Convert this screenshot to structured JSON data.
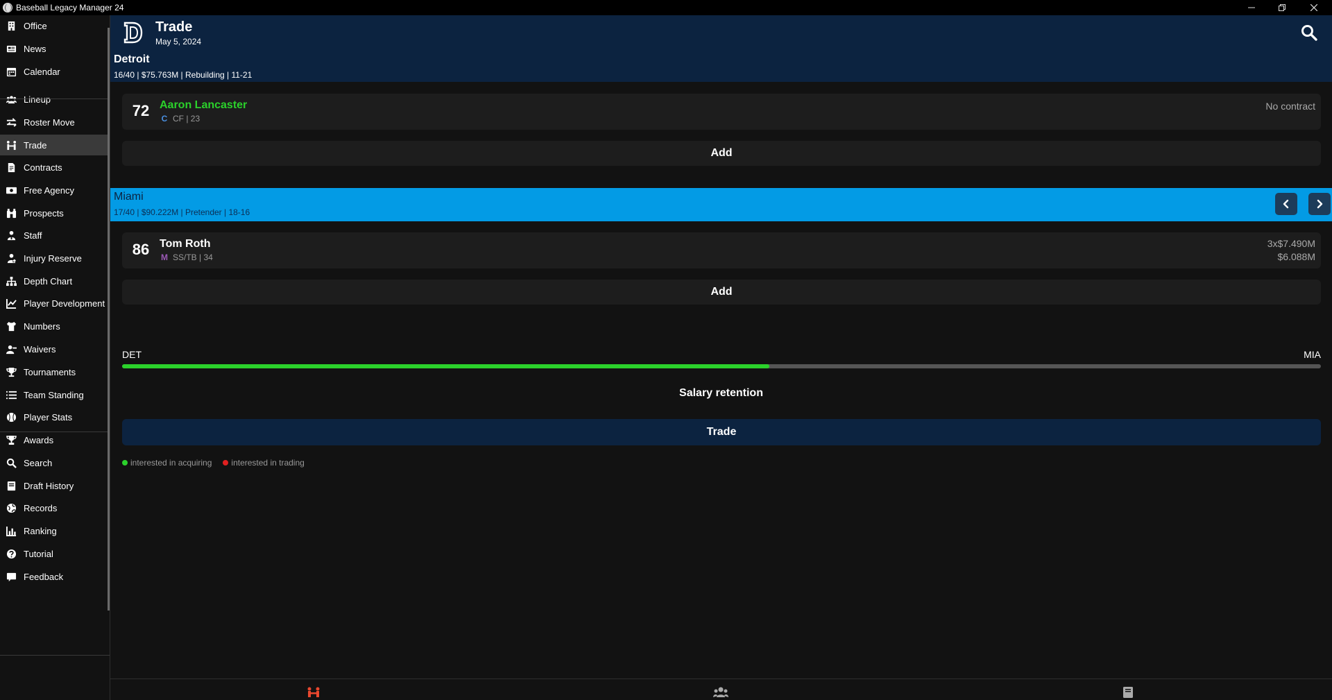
{
  "window": {
    "title": "Baseball Legacy Manager 24"
  },
  "sidebar": {
    "items": [
      {
        "label": "Office",
        "icon": "building-icon"
      },
      {
        "label": "News",
        "icon": "newspaper-icon"
      },
      {
        "label": "Calendar",
        "icon": "calendar-icon"
      },
      {
        "label": "Lineup",
        "icon": "users-icon"
      },
      {
        "label": "Roster Move",
        "icon": "swap-icon"
      },
      {
        "label": "Trade",
        "icon": "trade-icon",
        "active": true
      },
      {
        "label": "Contracts",
        "icon": "contract-icon"
      },
      {
        "label": "Free Agency",
        "icon": "money-icon"
      },
      {
        "label": "Prospects",
        "icon": "binoculars-icon"
      },
      {
        "label": "Staff",
        "icon": "staff-icon"
      },
      {
        "label": "Injury Reserve",
        "icon": "injury-icon"
      },
      {
        "label": "Depth Chart",
        "icon": "sitemap-icon"
      },
      {
        "label": "Player Development",
        "icon": "chart-line-icon"
      },
      {
        "label": "Numbers",
        "icon": "jersey-icon"
      },
      {
        "label": "Waivers",
        "icon": "user-minus-icon"
      },
      {
        "label": "Tournaments",
        "icon": "trophy-icon"
      },
      {
        "label": "Team Standing",
        "icon": "list-icon"
      },
      {
        "label": "Player Stats",
        "icon": "baseball-icon"
      },
      {
        "label": "Awards",
        "icon": "award-icon"
      },
      {
        "label": "Search",
        "icon": "search-icon"
      },
      {
        "label": "Draft History",
        "icon": "book-icon"
      },
      {
        "label": "Records",
        "icon": "globe-icon"
      },
      {
        "label": "Ranking",
        "icon": "bar-chart-icon"
      },
      {
        "label": "Tutorial",
        "icon": "question-icon"
      },
      {
        "label": "Feedback",
        "icon": "feedback-icon"
      }
    ]
  },
  "header": {
    "title": "Trade",
    "date": "May 5, 2024",
    "team_name": "Detroit",
    "team_info": "16/40 | $75.763M | Rebuilding | 11-21",
    "logo_letter": "D"
  },
  "my_side": {
    "players": [
      {
        "ovr": "72",
        "name": "Aaron Lancaster",
        "meta": "CF | 23",
        "contract": "No contract",
        "name_color": "#2bd12b",
        "team_logo_letter": "C",
        "team_logo_color": "#4a90e2"
      }
    ],
    "add_label": "Add"
  },
  "other_side": {
    "team_name": "Miami",
    "team_info": "17/40 | $90.222M | Pretender | 18-16",
    "players": [
      {
        "ovr": "86",
        "name": "Tom Roth",
        "meta": "SS/TB | 34",
        "contract_line1": "3x$7.490M",
        "contract_line2": "$6.088M",
        "name_color": "#ffffff",
        "team_logo_letter": "M",
        "team_logo_color": "#9b59b6"
      }
    ],
    "add_label": "Add"
  },
  "balance": {
    "left_label": "DET",
    "right_label": "MIA",
    "fraction": 0.54,
    "fill_color": "#2bd12b"
  },
  "salary_retention_label": "Salary retention",
  "trade_button_label": "Trade",
  "legend": {
    "acquire_label": "interested in acquiring",
    "acquire_color": "#2bd12b",
    "trading_label": "interested in trading",
    "trading_color": "#e02020"
  },
  "bottom_bar": {
    "icons": [
      "trade-icon",
      "users-icon",
      "book-icon"
    ],
    "active_color": "#e8472e"
  }
}
